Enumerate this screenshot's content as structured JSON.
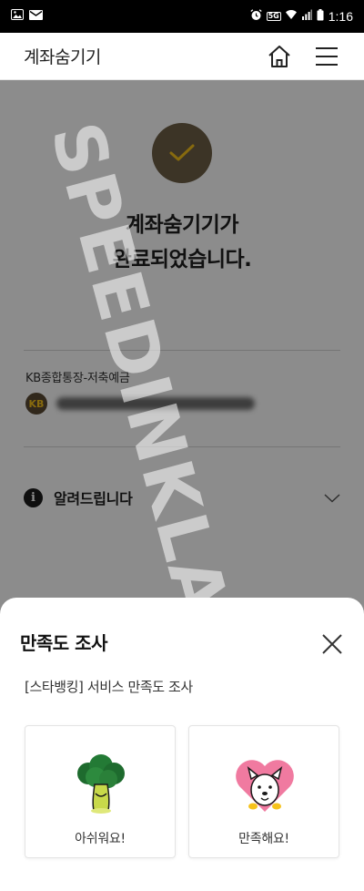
{
  "statusbar": {
    "network": "5G",
    "time": "1:16"
  },
  "header": {
    "title": "계좌숨기기",
    "home_icon": "home-icon",
    "menu_icon": "menu-icon"
  },
  "main": {
    "complete_line1": "계좌숨기기가",
    "complete_line2": "완료되었습니다.",
    "account_name": "KB종합통장-저축예금",
    "account_logo": "KB",
    "notice_label": "알려드립니다"
  },
  "watermark": "SPEEDINKLAND.COM",
  "survey": {
    "title": "만족도 조사",
    "subtitle": "[스타뱅킹] 서비스 만족도 조사",
    "option_bad": "아쉬워요!",
    "option_good": "만족해요!"
  },
  "colors": {
    "check_bg": "#6e5f45",
    "check_mark": "#f6c21b",
    "dim_overlay": "rgba(0,0,0,0.45)"
  }
}
